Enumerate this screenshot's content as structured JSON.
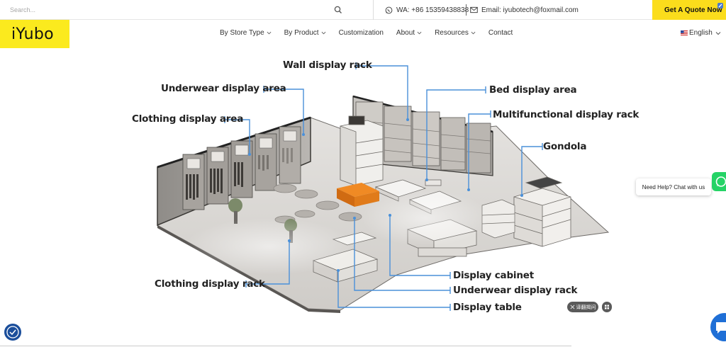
{
  "topbar": {
    "search_placeholder": "Search...",
    "whatsapp": "WA: +86 15359438838",
    "email": "Email: iyubotech@foxmail.com",
    "quote_button": "Get A Quote Now"
  },
  "header": {
    "logo": "iYubo",
    "nav": [
      {
        "label": "By Store Type"
      },
      {
        "label": "By Product"
      },
      {
        "label": "Customization"
      },
      {
        "label": "About"
      },
      {
        "label": "Resources"
      },
      {
        "label": "Contact"
      }
    ],
    "language": "English"
  },
  "diagram": {
    "labels": {
      "wall_display_rack": "Wall display rack",
      "underwear_display_area": "Underwear display area",
      "bed_display_area": "Bed display area",
      "clothing_display_area": "Clothing display area",
      "multifunctional_display_rack": "Multifunctional display rack",
      "gondola": "Gondola",
      "clothing_display_rack": "Clothing display rack",
      "display_cabinet": "Display cabinet",
      "underwear_display_rack": "Underwear display rack",
      "display_table": "Display table"
    },
    "leader_color": "#4a90d9",
    "accent_orange": "#f08a24"
  },
  "widgets": {
    "help_text": "Need Help? Chat with us",
    "translate_text": "译翻揭问",
    "whatsapp_color": "#25d366",
    "chat_color": "#1f6fd6"
  },
  "colors": {
    "brand_yellow": "#fbea1e",
    "quote_yellow": "#fbdd1c"
  }
}
